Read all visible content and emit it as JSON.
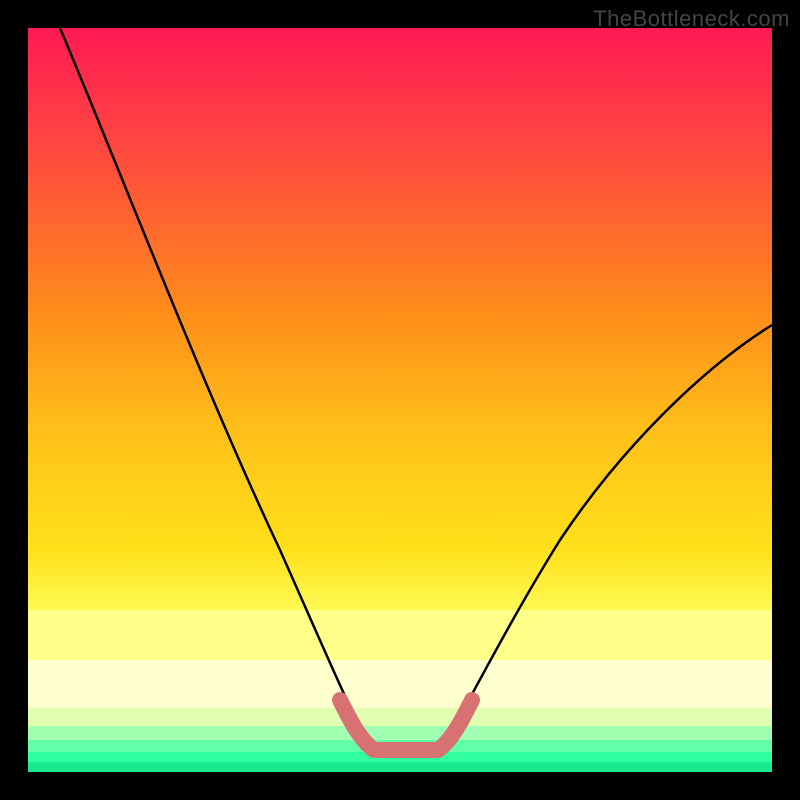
{
  "watermark": "TheBottleneck.com",
  "chart_data": {
    "type": "line",
    "title": "",
    "xlabel": "",
    "ylabel": "",
    "xlim": [
      0,
      100
    ],
    "ylim": [
      0,
      100
    ],
    "background_gradient": {
      "top": "#ff1a4d",
      "mid1": "#ff8c1a",
      "mid2": "#ffe01a",
      "mid3": "#ffff80",
      "bottom": "#1aff99"
    },
    "series": [
      {
        "name": "left-curve",
        "x": [
          0,
          5,
          10,
          15,
          20,
          25,
          30,
          35,
          40,
          42,
          44,
          46
        ],
        "y": [
          100,
          93,
          85,
          76,
          67,
          57,
          47,
          36,
          22,
          14,
          6,
          0
        ]
      },
      {
        "name": "right-curve",
        "x": [
          54,
          56,
          58,
          62,
          66,
          72,
          78,
          84,
          90,
          96,
          100
        ],
        "y": [
          0,
          5,
          10,
          18,
          25,
          33,
          40,
          46,
          52,
          57,
          59
        ]
      },
      {
        "name": "flat-min",
        "x": [
          46,
          54
        ],
        "y": [
          0,
          0
        ]
      }
    ],
    "overlay_band": {
      "name": "salmon-band",
      "color": "#e07070",
      "x": [
        41,
        42,
        44,
        46,
        54,
        56,
        58,
        59
      ],
      "y": [
        8,
        6,
        2,
        0,
        0,
        2,
        6,
        8
      ]
    },
    "bottom_bands": [
      {
        "color": "#ffff99",
        "y0": 78,
        "y1": 83
      },
      {
        "color": "#ffffc0",
        "y0": 83,
        "y1": 88
      },
      {
        "color": "#d0ffa0",
        "y0": 88,
        "y1": 91
      },
      {
        "color": "#80ffb0",
        "y0": 91,
        "y1": 94
      },
      {
        "color": "#40ffa0",
        "y0": 94,
        "y1": 96
      },
      {
        "color": "#1aff99",
        "y0": 96,
        "y1": 98
      }
    ]
  }
}
